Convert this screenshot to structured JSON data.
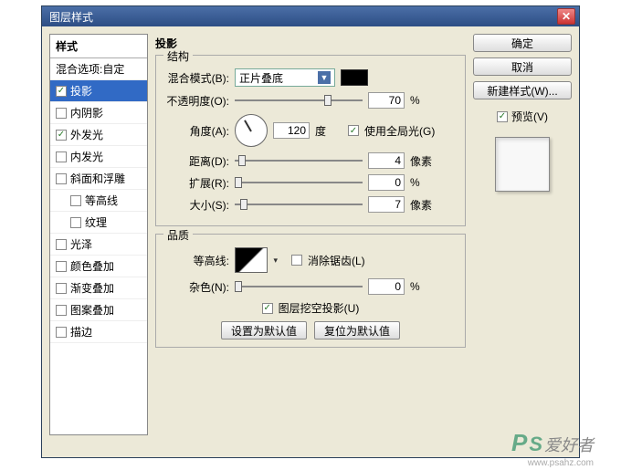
{
  "window": {
    "title": "图层样式"
  },
  "styles": {
    "header": "样式",
    "blend_options": "混合选项:自定",
    "items": [
      {
        "label": "投影",
        "checked": true,
        "selected": true
      },
      {
        "label": "内阴影",
        "checked": false
      },
      {
        "label": "外发光",
        "checked": true
      },
      {
        "label": "内发光",
        "checked": false
      },
      {
        "label": "斜面和浮雕",
        "checked": false
      },
      {
        "label": "等高线",
        "checked": false,
        "sub": true
      },
      {
        "label": "纹理",
        "checked": false,
        "sub": true
      },
      {
        "label": "光泽",
        "checked": false
      },
      {
        "label": "颜色叠加",
        "checked": false
      },
      {
        "label": "渐变叠加",
        "checked": false
      },
      {
        "label": "图案叠加",
        "checked": false
      },
      {
        "label": "描边",
        "checked": false
      }
    ]
  },
  "panel": {
    "title": "投影",
    "structure_legend": "结构",
    "blend_mode_label": "混合模式(B):",
    "blend_mode_value": "正片叠底",
    "color": "#000000",
    "opacity_label": "不透明度(O):",
    "opacity_value": "70",
    "opacity_unit": "%",
    "angle_label": "角度(A):",
    "angle_value": "120",
    "angle_unit": "度",
    "global_light_label": "使用全局光(G)",
    "global_light_checked": true,
    "distance_label": "距离(D):",
    "distance_value": "4",
    "distance_unit": "像素",
    "spread_label": "扩展(R):",
    "spread_value": "0",
    "spread_unit": "%",
    "size_label": "大小(S):",
    "size_value": "7",
    "size_unit": "像素",
    "quality_legend": "品质",
    "contour_label": "等高线:",
    "antialias_label": "消除锯齿(L)",
    "antialias_checked": false,
    "noise_label": "杂色(N):",
    "noise_value": "0",
    "noise_unit": "%",
    "knockout_label": "图层挖空投影(U)",
    "knockout_checked": true,
    "set_default": "设置为默认值",
    "reset_default": "复位为默认值"
  },
  "right": {
    "ok": "确定",
    "cancel": "取消",
    "new_style": "新建样式(W)...",
    "preview_label": "预览(V)",
    "preview_checked": true
  },
  "watermark": {
    "site": "www.psahz.com",
    "tag": "爱好者"
  }
}
